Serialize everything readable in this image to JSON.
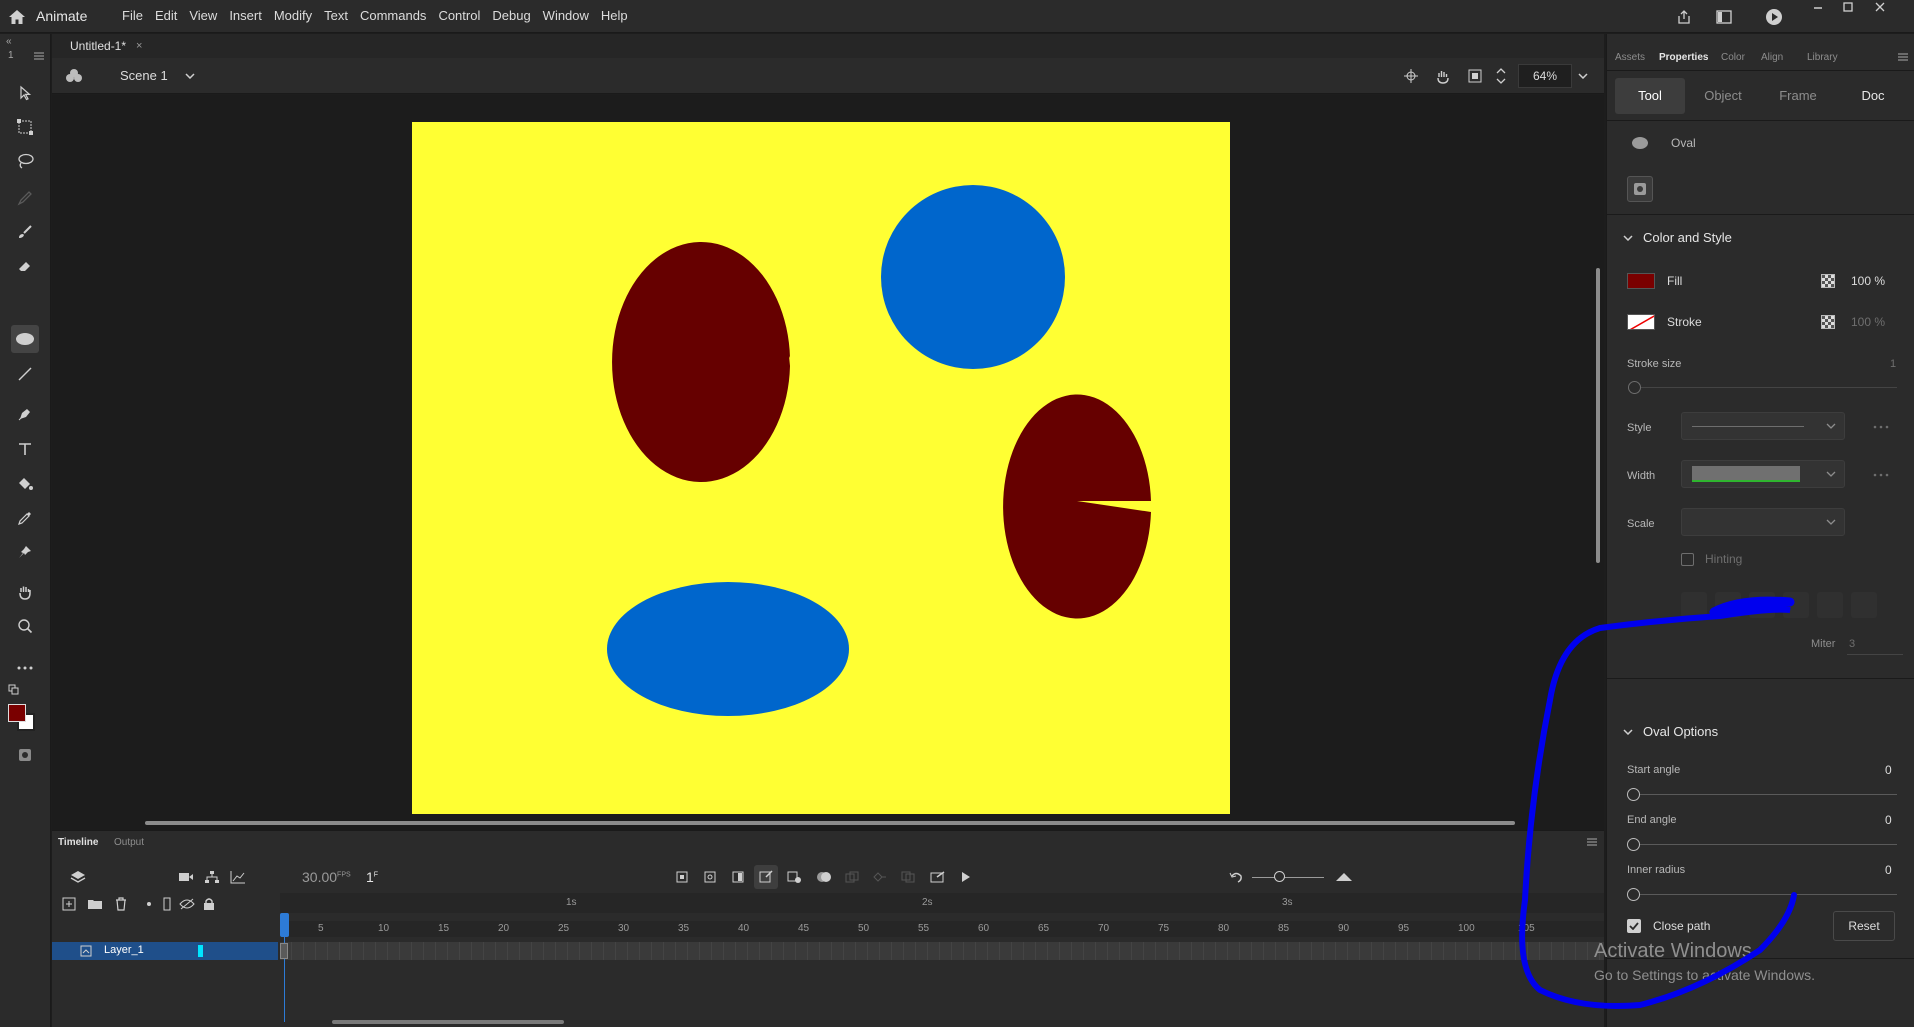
{
  "app": {
    "name": "Animate"
  },
  "menu": [
    "File",
    "Edit",
    "View",
    "Insert",
    "Modify",
    "Text",
    "Commands",
    "Control",
    "Debug",
    "Window",
    "Help"
  ],
  "document": {
    "tab_title": "Untitled-1*",
    "scene": "Scene 1",
    "zoom": "64%"
  },
  "toolbar": {
    "label_top": "1"
  },
  "colors": {
    "stage": "#ffff33",
    "dark_red": "#660000",
    "blue": "#0066cc",
    "fill_swatch": "#7a0000",
    "accent": "#1e90ff",
    "annotation": "#0000ee"
  },
  "timeline": {
    "tabs": [
      "Timeline",
      "Output"
    ],
    "fps": "30.00",
    "fps_unit": "FPS",
    "frame": "1",
    "frame_unit": "F",
    "layer_name": "Layer_1",
    "seconds": [
      "1s",
      "2s",
      "3s"
    ],
    "frame_numbers": [
      "5",
      "10",
      "15",
      "20",
      "25",
      "30",
      "35",
      "40",
      "45",
      "50",
      "55",
      "60",
      "65",
      "70",
      "75",
      "80",
      "85",
      "90",
      "95",
      "100",
      "105"
    ]
  },
  "panel": {
    "tabs": [
      "Assets",
      "Properties",
      "Color",
      "Align",
      "Library"
    ],
    "active_tab": "Properties",
    "segments": [
      "Tool",
      "Object",
      "Frame",
      "Doc"
    ],
    "active_segment": "Tool",
    "tool_name": "Oval",
    "color_style": {
      "title": "Color and Style",
      "fill_label": "Fill",
      "fill_percent": "100 %",
      "stroke_label": "Stroke",
      "stroke_percent": "100 %",
      "stroke_size_label": "Stroke size",
      "stroke_size_value": "1",
      "style_label": "Style",
      "width_label": "Width",
      "scale_label": "Scale",
      "hinting_label": "Hinting",
      "miter_label": "Miter",
      "miter_value": "3"
    },
    "oval_options": {
      "title": "Oval Options",
      "start_angle_label": "Start angle",
      "start_angle_value": "0",
      "end_angle_label": "End angle",
      "end_angle_value": "0",
      "inner_radius_label": "Inner radius",
      "inner_radius_value": "0",
      "close_path_label": "Close path",
      "close_path_checked": true,
      "reset_label": "Reset"
    }
  },
  "watermark": {
    "title": "Activate Windows",
    "subtitle": "Go to Settings to activate Windows."
  }
}
